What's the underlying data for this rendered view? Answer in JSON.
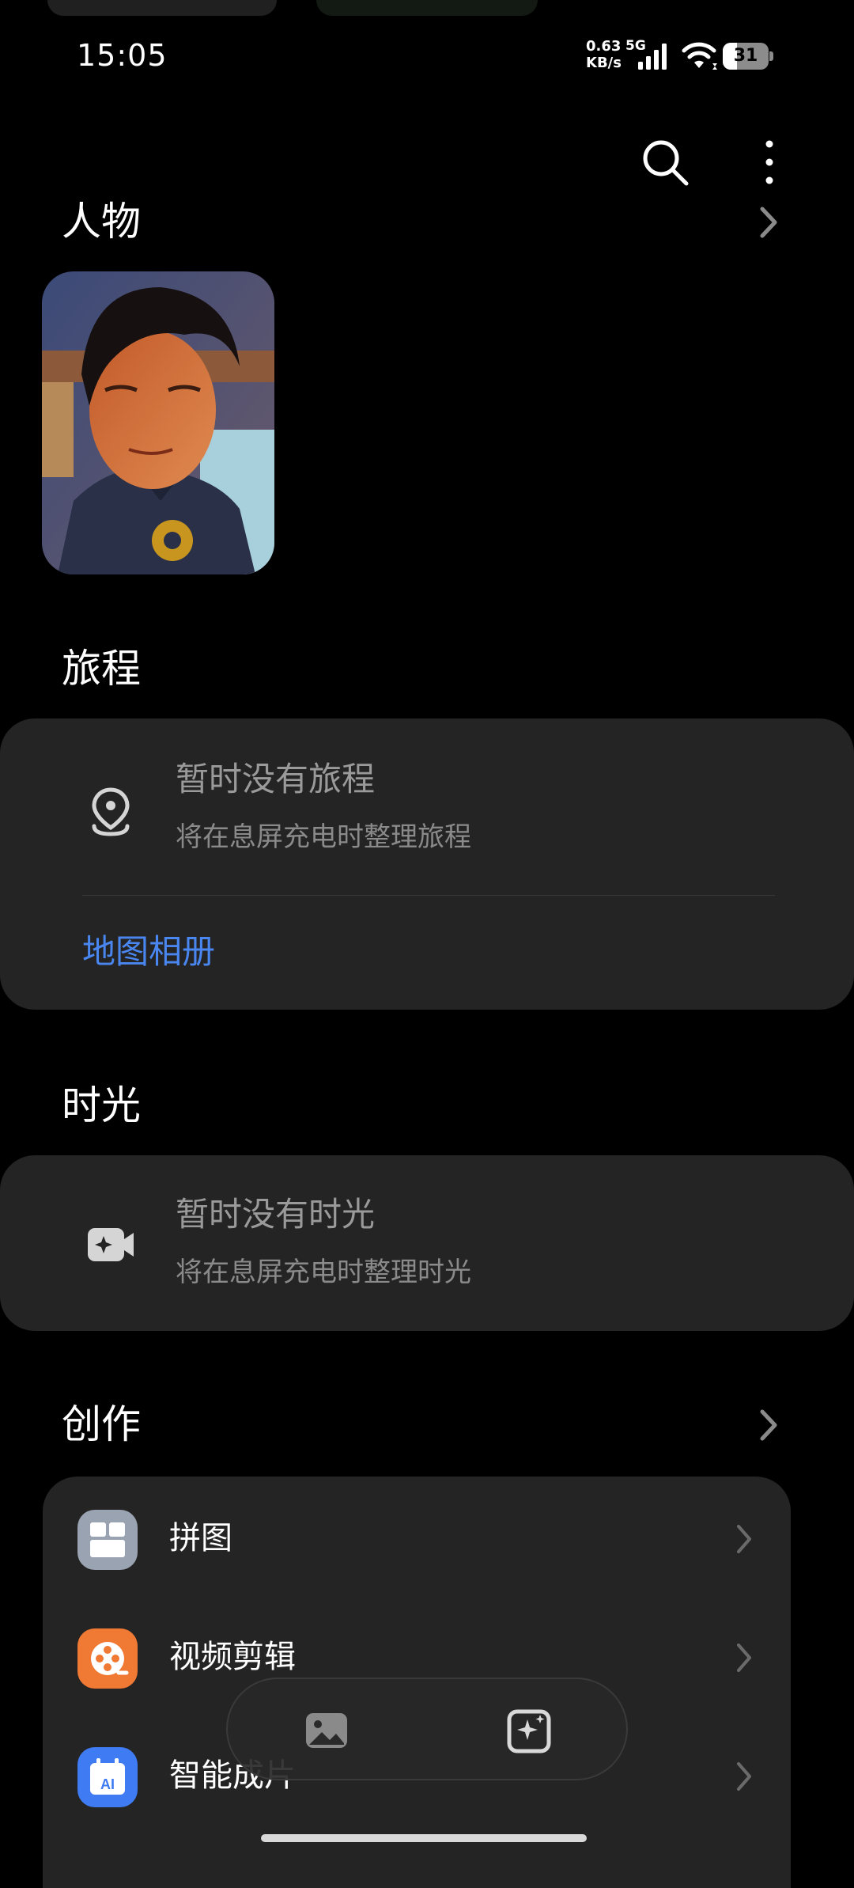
{
  "status_bar": {
    "time": "15:05",
    "net_speed": "0.63",
    "net_unit": "KB/s",
    "network_gen": "5G",
    "battery": "31",
    "battery_level": 0.31
  },
  "header": {
    "search_icon": "search-icon",
    "more_icon": "more-vertical-icon"
  },
  "people": {
    "title": "人物"
  },
  "journey": {
    "title": "旅程",
    "empty_title": "暂时没有旅程",
    "empty_subtitle": "将在息屏充电时整理旅程",
    "map_link": "地图相册",
    "icon": "location-pin-icon"
  },
  "moments": {
    "title": "时光",
    "empty_title": "暂时没有时光",
    "empty_subtitle": "将在息屏充电时整理时光",
    "icon": "memory-video-icon"
  },
  "creation": {
    "title": "创作",
    "items": [
      {
        "label": "拼图",
        "icon": "collage-icon",
        "color": "#9aa3b2"
      },
      {
        "label": "视频剪辑",
        "icon": "film-reel-icon",
        "color": "#f07a34"
      },
      {
        "label": "智能成片",
        "icon": "ai-calendar-icon",
        "color": "#3f7bf3"
      }
    ]
  },
  "bottom_bar": {
    "left_icon": "photos-icon",
    "right_icon": "ai-sparkle-icon"
  },
  "colors": {
    "background": "#000000",
    "card": "#242424",
    "accent_link": "#4a86f0",
    "muted_text": "#9a9a9a"
  }
}
